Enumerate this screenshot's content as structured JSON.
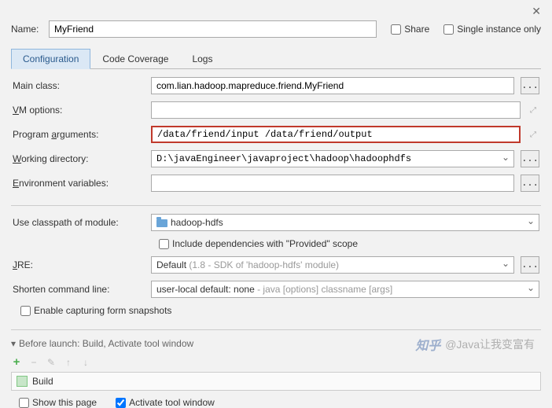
{
  "close": "✕",
  "nameLabel": "Name:",
  "nameValue": "MyFriend",
  "share": "Share",
  "singleInstance": "Single instance only",
  "tabs": {
    "config": "Configuration",
    "coverage": "Code Coverage",
    "logs": "Logs"
  },
  "labels": {
    "mainClass": "Main class:",
    "vmOptions": "VM options:",
    "programArgs": "Program arguments:",
    "workingDir": "Working directory:",
    "envVars": "Environment variables:",
    "classpath": "Use classpath of module:",
    "includeDeps": "Include dependencies with \"Provided\" scope",
    "jre": "JRE:",
    "shorten": "Shorten command line:",
    "enableCapture": "Enable capturing form snapshots"
  },
  "underlines": {
    "vm": "V",
    "args": "a",
    "work": "W",
    "env": "E",
    "jre": "J"
  },
  "values": {
    "mainClass": "com.lian.hadoop.mapreduce.friend.MyFriend",
    "programArgs": "/data/friend/input /data/friend/output",
    "workingDir": "D:\\javaEngineer\\javaproject\\hadoop\\hadoophdfs",
    "classpath": "hadoop-hdfs",
    "jre": "Default (1.8 - SDK of 'hadoop-hdfs' module)",
    "jreDefault": "Default",
    "jreGray": " (1.8 - SDK of 'hadoop-hdfs' module)",
    "shorten": "user-local default: none",
    "shortenGray": " - java [options] classname [args]"
  },
  "beforeLaunch": "Before launch: Build, Activate tool window",
  "build": "Build",
  "showThisPage": "Show this page",
  "activateTool": "Activate tool window",
  "browse": "...",
  "triangle": "▾",
  "watermark": {
    "logo": "知乎",
    "text": "@Java让我变富有"
  }
}
